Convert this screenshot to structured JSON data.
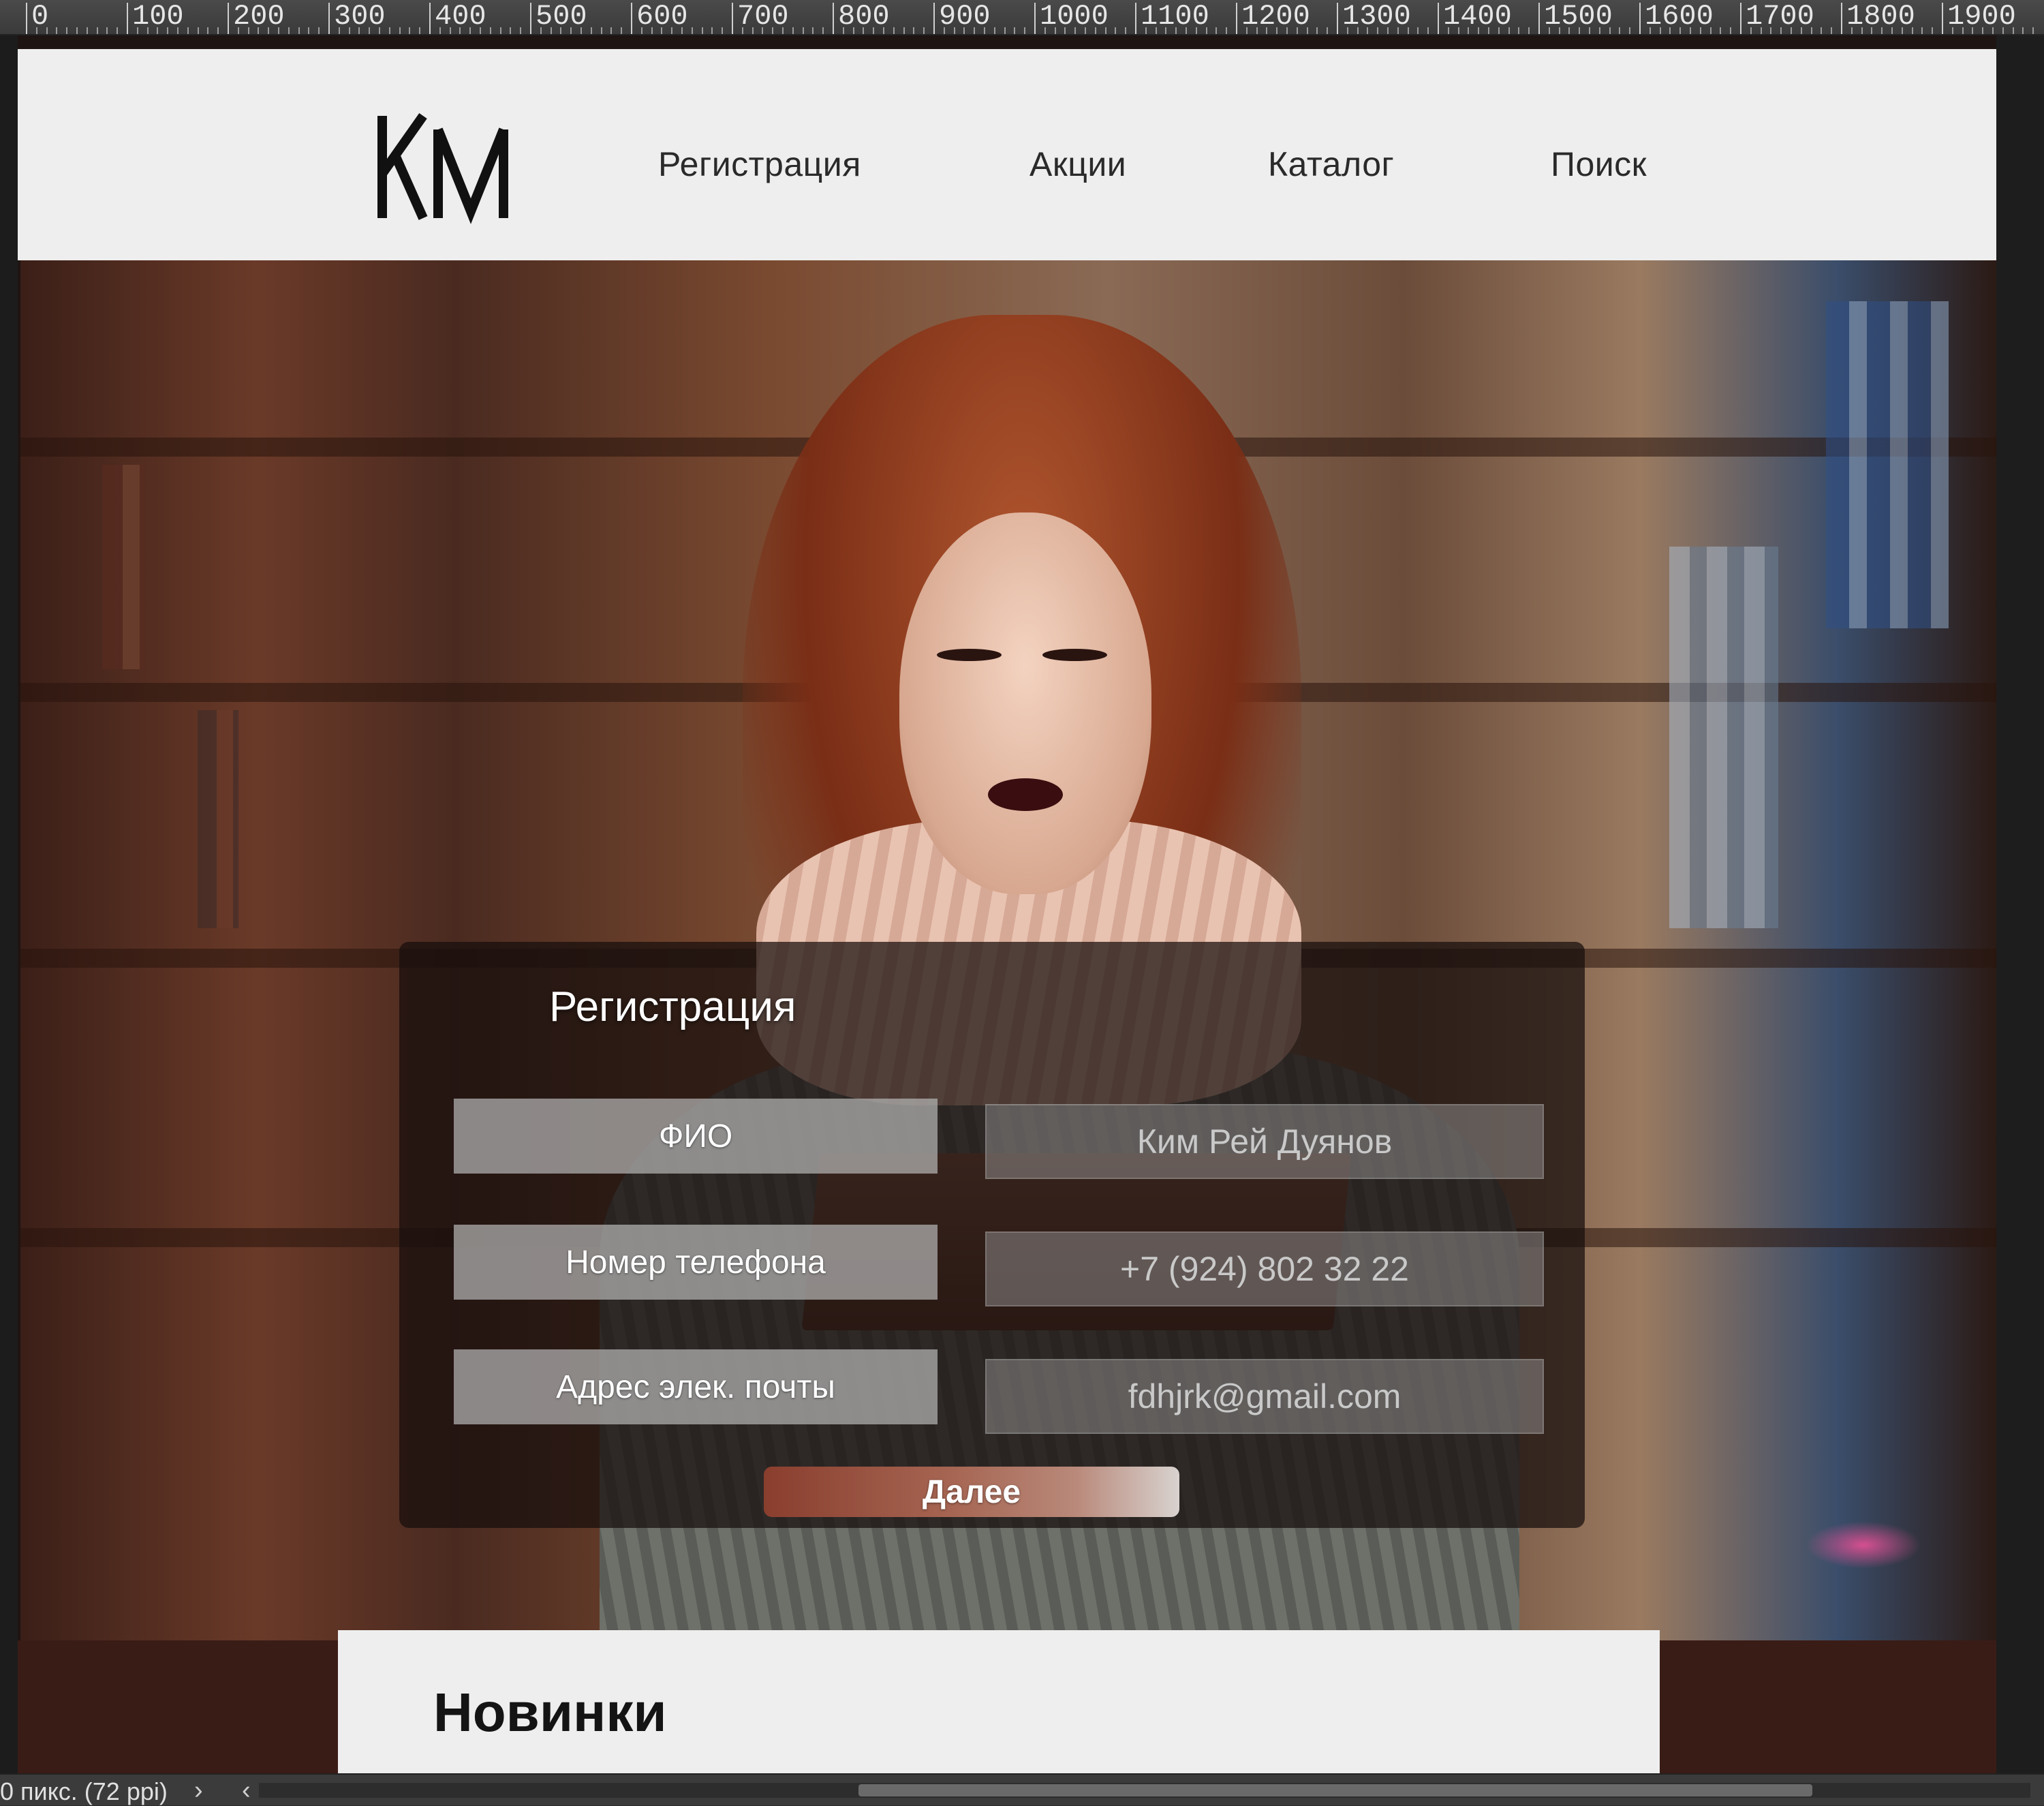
{
  "ruler": {
    "labels": [
      "0",
      "100",
      "200",
      "300",
      "400",
      "500",
      "600",
      "700",
      "800",
      "900",
      "1000",
      "1100",
      "1200",
      "1300",
      "1400",
      "1500",
      "1600",
      "1700",
      "1800",
      "1900"
    ]
  },
  "site": {
    "logo_text": "KM",
    "nav": [
      "Регистрация",
      "Акции",
      "Каталог",
      "Поиск"
    ]
  },
  "registration": {
    "title": "Регистрация",
    "fields": [
      {
        "label": "ФИО",
        "value": "Ким Рей Дуянов"
      },
      {
        "label": "Номер телефона",
        "value": "+7 (924) 802 32 22"
      },
      {
        "label": "Адрес элек. почты",
        "value": "fdhjrk@gmail.com"
      }
    ],
    "submit_label": "Далее"
  },
  "new_section": {
    "title": "Новинки"
  },
  "status": {
    "size_text": "0 пикс. (72 ppi)",
    "arrow_right": "›",
    "arrow_left": "‹"
  },
  "colors": {
    "header_bg": "#eeeeee",
    "panel_bg": "rgba(22,14,12,0.72)",
    "button_accent": "#8a3e2e"
  }
}
